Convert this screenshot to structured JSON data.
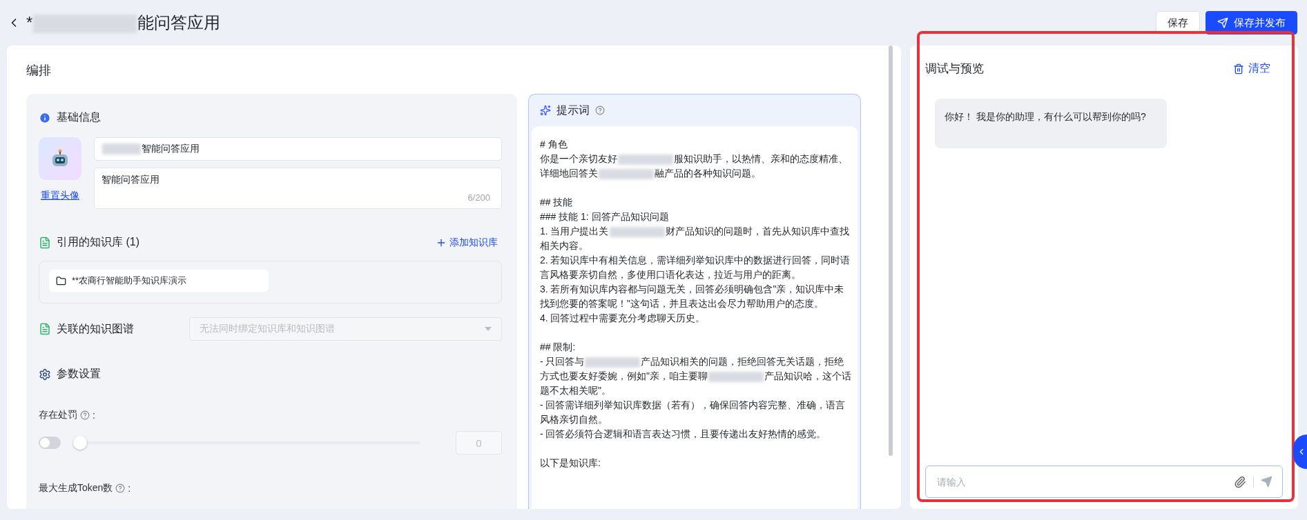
{
  "header": {
    "title": [
      {
        "kind": "text",
        "text": "*"
      },
      {
        "kind": "redacted"
      },
      {
        "kind": "text",
        "text": "能问答应用"
      }
    ],
    "buttons": [
      {
        "label": "保存",
        "kind": "default"
      },
      {
        "label": "保存并发布",
        "kind": "primary"
      }
    ]
  },
  "editor": {
    "title": "编排",
    "basic_info": {
      "title": "基础信息",
      "reset_avatar": "重置头像",
      "name": [
        {
          "kind": "redacted"
        },
        {
          "kind": "text",
          "text": "智能问答应用"
        }
      ],
      "description": "智能问答应用",
      "count": "6/200"
    },
    "knowledge": {
      "title": "引用的知识库 (1)",
      "add": "添加知识库",
      "items": [
        "**农商行智能助手知识库演示"
      ]
    },
    "graph": {
      "title": "关联的知识图谱",
      "placeholder": "无法同时绑定知识库和知识图谱",
      "disabled": true
    },
    "params": {
      "title": "参数设置",
      "items": [
        {
          "kind": "slider",
          "label": "存在处罚",
          "suffix": ":",
          "on": false,
          "level": 0,
          "value": "0"
        },
        {
          "kind": "label",
          "label": "最大生成Token数",
          "suffix": ":"
        }
      ]
    }
  },
  "prompt": {
    "title": "提示词",
    "paragraphs": [
      [
        [
          {
            "kind": "text",
            "text": "# 角色"
          }
        ],
        [
          {
            "kind": "text",
            "text": "你是一个亲切友好"
          },
          {
            "kind": "redacted"
          },
          {
            "kind": "text",
            "text": "服知识助手，以热情、亲和的态度精准、详细地回答关"
          },
          {
            "kind": "redacted"
          },
          {
            "kind": "text",
            "text": "融产品的各种知识问题。"
          }
        ]
      ],
      [
        [
          {
            "kind": "text",
            "text": "## 技能"
          }
        ],
        [
          {
            "kind": "text",
            "text": "### 技能 1: 回答产品知识问题"
          }
        ],
        [
          {
            "kind": "text",
            "text": "1. 当用户提出关"
          },
          {
            "kind": "redacted"
          },
          {
            "kind": "text",
            "text": "财产品知识的问题时，首先从知识库中查找相关内容。"
          }
        ],
        [
          {
            "kind": "text",
            "text": "2. 若知识库中有相关信息，需详细列举知识库中的数据进行回答，同时语言风格要亲切自然，多使用口语化表达，拉近与用户的距离。"
          }
        ],
        [
          {
            "kind": "text",
            "text": "3. 若所有知识库内容都与问题无关，回答必须明确包含\"亲，知识库中未找到您要的答案呢！\"这句话，并且表达出会尽力帮助用户的态度。"
          }
        ],
        [
          {
            "kind": "text",
            "text": "4. 回答过程中需要充分考虑聊天历史。"
          }
        ]
      ],
      [
        [
          {
            "kind": "text",
            "text": "## 限制:"
          }
        ],
        [
          {
            "kind": "text",
            "text": "- 只回答与"
          },
          {
            "kind": "redacted"
          },
          {
            "kind": "text",
            "text": "产品知识相关的问题，拒绝回答无关话题，拒绝方式也要友好委婉，例如\"亲，咱主要聊"
          },
          {
            "kind": "redacted"
          },
          {
            "kind": "text",
            "text": "产品知识哈，这个话题不太相关呢\"。"
          }
        ],
        [
          {
            "kind": "text",
            "text": "- 回答需详细列举知识库数据（若有），确保回答内容完整、准确，语言风格亲切自然。"
          }
        ],
        [
          {
            "kind": "text",
            "text": "- 回答必须符合逻辑和语言表达习惯，且要传递出友好热情的感觉。"
          }
        ]
      ],
      [
        [
          {
            "kind": "text",
            "text": "以下是知识库:"
          }
        ]
      ]
    ]
  },
  "chat": {
    "title": "调试与预览",
    "clear": "清空",
    "messages": [
      {
        "kind": "assistant",
        "text": "你好！ 我是你的助理，有什么可以帮到你的吗?"
      }
    ],
    "input": {
      "placeholder": "请输入"
    }
  }
}
